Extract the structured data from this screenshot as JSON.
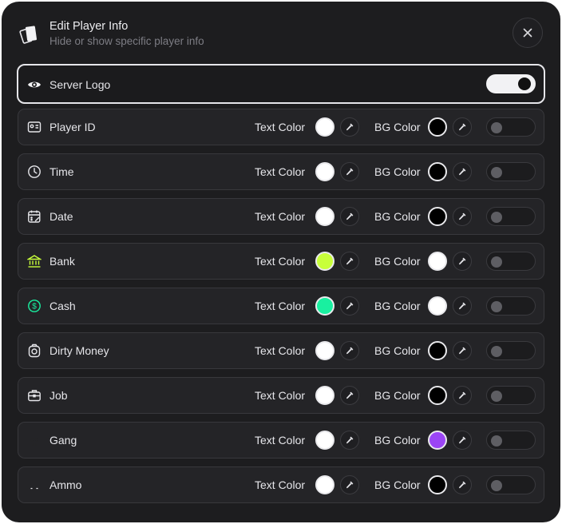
{
  "header": {
    "title": "Edit Player Info",
    "subtitle": "Hide or show specific player info"
  },
  "labels": {
    "text_color": "Text Color",
    "bg_color": "BG Color"
  },
  "server_logo": {
    "label": "Server Logo",
    "icon": "eye-icon",
    "enabled": true
  },
  "items": [
    {
      "label": "Player ID",
      "icon": "id-card-icon",
      "icon_color": "#e6e6ea",
      "text_color": "#ffffff",
      "bg_color": "#000000",
      "enabled": false
    },
    {
      "label": "Time",
      "icon": "clock-icon",
      "icon_color": "#e6e6ea",
      "text_color": "#ffffff",
      "bg_color": "#000000",
      "enabled": false
    },
    {
      "label": "Date",
      "icon": "calendar-icon",
      "icon_color": "#e6e6ea",
      "text_color": "#ffffff",
      "bg_color": "#000000",
      "enabled": false
    },
    {
      "label": "Bank",
      "icon": "bank-icon",
      "icon_color": "#c8ff3a",
      "text_color": "#c8ff3a",
      "bg_color": "#ffffff",
      "enabled": false
    },
    {
      "label": "Cash",
      "icon": "dollar-icon",
      "icon_color": "#19f0a0",
      "text_color": "#19f0a0",
      "bg_color": "#ffffff",
      "enabled": false
    },
    {
      "label": "Dirty Money",
      "icon": "money-bag-icon",
      "icon_color": "#e6e6ea",
      "text_color": "#ffffff",
      "bg_color": "#000000",
      "enabled": false
    },
    {
      "label": "Job",
      "icon": "briefcase-icon",
      "icon_color": "#e6e6ea",
      "text_color": "#ffffff",
      "bg_color": "#000000",
      "enabled": false
    },
    {
      "label": "Gang",
      "icon": "skull-icon",
      "icon_color": "#e6e6ea",
      "text_color": "#ffffff",
      "bg_color": "#9b45f5",
      "enabled": false
    },
    {
      "label": "Ammo",
      "icon": "ammo-icon",
      "icon_color": "#e6e6ea",
      "text_color": "#ffffff",
      "bg_color": "#000000",
      "enabled": false
    }
  ]
}
